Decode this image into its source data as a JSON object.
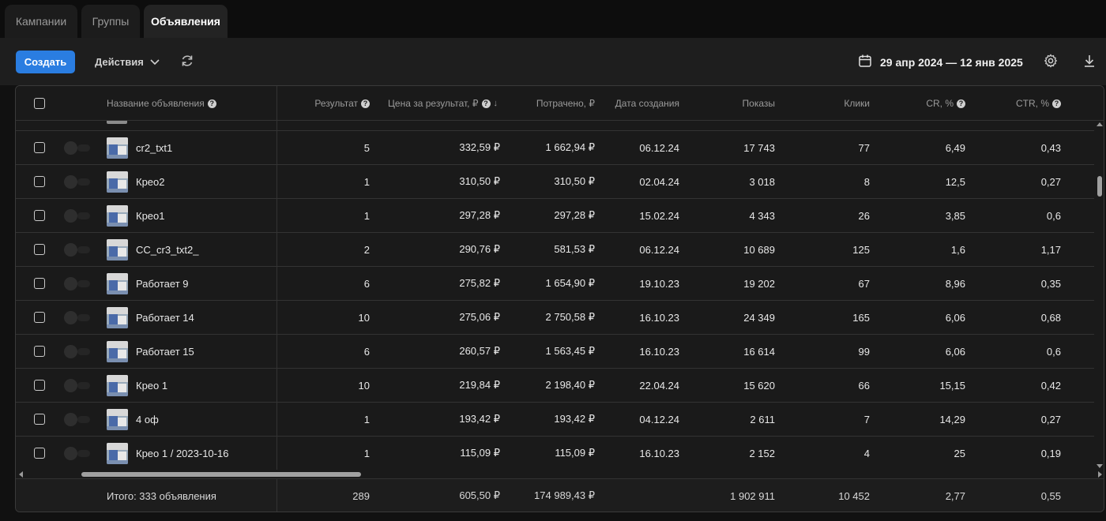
{
  "tabs": [
    {
      "label": "Кампании",
      "active": false
    },
    {
      "label": "Группы",
      "active": false
    },
    {
      "label": "Объявления",
      "active": true
    }
  ],
  "toolbar": {
    "create_label": "Создать",
    "actions_label": "Действия",
    "date_range": "29 апр 2024 — 12 янв 2025"
  },
  "colors": {
    "accent": "#2a7de1",
    "background": "#111111",
    "table_bg": "#1a1a1a"
  },
  "table": {
    "columns": {
      "name": "Название объявления",
      "result": "Результат",
      "price": "Цена за результат, ₽",
      "spent": "Потрачено, ₽",
      "created": "Дата создания",
      "impressions": "Показы",
      "clicks": "Клики",
      "cr": "CR, %",
      "ctr": "CTR, %"
    },
    "rows": [
      {
        "name": "cr2_txt1",
        "result": "5",
        "price": "332,59 ₽",
        "spent": "1 662,94 ₽",
        "created": "06.12.24",
        "impressions": "17 743",
        "clicks": "77",
        "cr": "6,49",
        "ctr": "0,43"
      },
      {
        "name": "Крео2",
        "result": "1",
        "price": "310,50 ₽",
        "spent": "310,50 ₽",
        "created": "02.04.24",
        "impressions": "3 018",
        "clicks": "8",
        "cr": "12,5",
        "ctr": "0,27"
      },
      {
        "name": "Крео1",
        "result": "1",
        "price": "297,28 ₽",
        "spent": "297,28 ₽",
        "created": "15.02.24",
        "impressions": "4 343",
        "clicks": "26",
        "cr": "3,85",
        "ctr": "0,6"
      },
      {
        "name": "CC_cr3_txt2_",
        "result": "2",
        "price": "290,76 ₽",
        "spent": "581,53 ₽",
        "created": "06.12.24",
        "impressions": "10 689",
        "clicks": "125",
        "cr": "1,6",
        "ctr": "1,17"
      },
      {
        "name": "Работает 9",
        "result": "6",
        "price": "275,82 ₽",
        "spent": "1 654,90 ₽",
        "created": "19.10.23",
        "impressions": "19 202",
        "clicks": "67",
        "cr": "8,96",
        "ctr": "0,35"
      },
      {
        "name": "Работает 14",
        "result": "10",
        "price": "275,06 ₽",
        "spent": "2 750,58 ₽",
        "created": "16.10.23",
        "impressions": "24 349",
        "clicks": "165",
        "cr": "6,06",
        "ctr": "0,68"
      },
      {
        "name": "Работает 15",
        "result": "6",
        "price": "260,57 ₽",
        "spent": "1 563,45 ₽",
        "created": "16.10.23",
        "impressions": "16 614",
        "clicks": "99",
        "cr": "6,06",
        "ctr": "0,6"
      },
      {
        "name": "Крео 1",
        "result": "10",
        "price": "219,84 ₽",
        "spent": "2 198,40 ₽",
        "created": "22.04.24",
        "impressions": "15 620",
        "clicks": "66",
        "cr": "15,15",
        "ctr": "0,42"
      },
      {
        "name": "4 оф",
        "result": "1",
        "price": "193,42 ₽",
        "spent": "193,42 ₽",
        "created": "04.12.24",
        "impressions": "2 611",
        "clicks": "7",
        "cr": "14,29",
        "ctr": "0,27"
      },
      {
        "name": "Крео 1 / 2023-10-16",
        "result": "1",
        "price": "115,09 ₽",
        "spent": "115,09 ₽",
        "created": "16.10.23",
        "impressions": "2 152",
        "clicks": "4",
        "cr": "25",
        "ctr": "0,19"
      }
    ],
    "totals": {
      "label": "Итого: 333 объявления",
      "result": "289",
      "price": "605,50 ₽",
      "spent": "174 989,43 ₽",
      "impressions": "1 902 911",
      "clicks": "10 452",
      "cr": "2,77",
      "ctr": "0,55"
    }
  },
  "icons": {
    "refresh": "refresh-icon",
    "calendar": "calendar-icon",
    "settings": "gear-icon",
    "download": "download-icon",
    "help": "question-icon",
    "sort": "sort-down-icon",
    "chevron": "chevron-down-icon"
  }
}
